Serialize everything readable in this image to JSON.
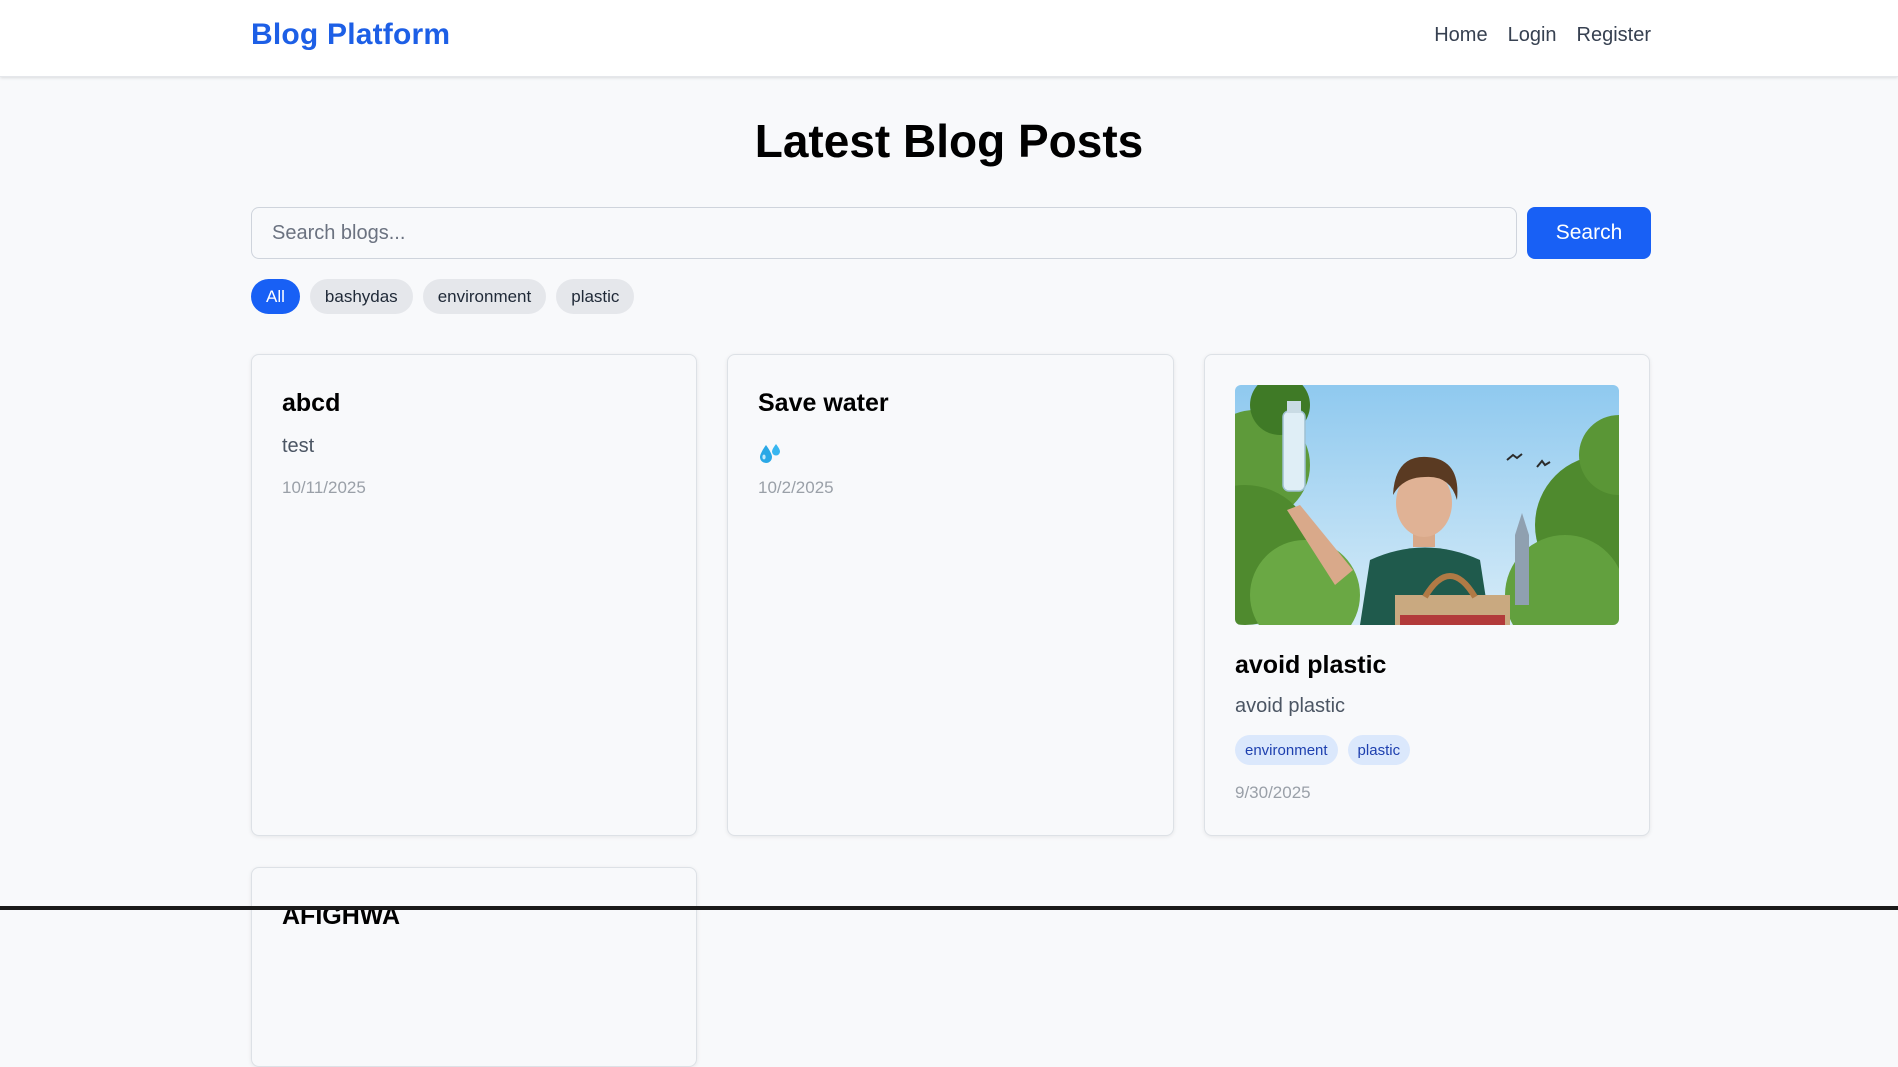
{
  "header": {
    "brand": "Blog Platform",
    "nav": [
      "Home",
      "Login",
      "Register"
    ]
  },
  "main": {
    "title": "Latest Blog Posts",
    "search": {
      "placeholder": "Search blogs...",
      "value": "",
      "button_label": "Search"
    },
    "filters": [
      {
        "label": "All",
        "active": true
      },
      {
        "label": "bashydas",
        "active": false
      },
      {
        "label": "environment",
        "active": false
      },
      {
        "label": "plastic",
        "active": false
      }
    ],
    "posts": [
      {
        "title": "abcd",
        "excerpt": "test",
        "date": "10/11/2025",
        "tags": []
      },
      {
        "title": "Save water",
        "excerpt_icon": "water-droplets-emoji-icon",
        "date": "10/2/2025",
        "tags": []
      },
      {
        "title": "avoid plastic",
        "excerpt": "avoid plastic",
        "date": "9/30/2025",
        "image": "man-holding-water-bottle-photo",
        "tags": [
          "environment",
          "plastic"
        ]
      },
      {
        "title": "AFIGHWA"
      }
    ]
  },
  "colors": {
    "brand": "#1d5fe6",
    "primary_button": "#1860f5",
    "tag_bg": "#dbe8fc",
    "tag_text": "#1e40af",
    "page_bg": "#f8f9fb"
  }
}
